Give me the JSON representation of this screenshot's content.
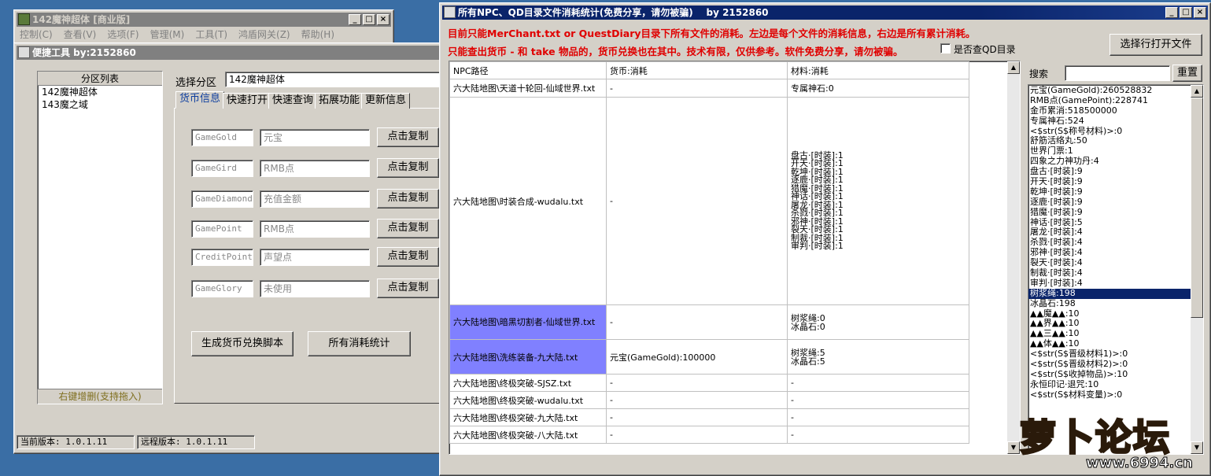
{
  "win1": {
    "title": "142魔神超体 [商业版]",
    "menu": [
      "控制(C)",
      "查看(V)",
      "选项(F)",
      "管理(M)",
      "工具(T)",
      "鸿盾网关(Z)",
      "帮助(H)"
    ]
  },
  "win2": {
    "title": "便捷工具 by:2152860",
    "partition_header": "分区列表",
    "partitions": [
      "142魔神超体",
      "143魔之域"
    ],
    "partition_footer": "右键增删(支持拖入)",
    "select_label": "选择分区",
    "select_value": "142魔神超体",
    "tabs": [
      "货币信息",
      "快速打开",
      "快速查询",
      "拓展功能",
      "更新信息"
    ],
    "currency_rows": [
      {
        "code": "GameGold",
        "name": "元宝",
        "btn": "点击复制"
      },
      {
        "code": "GameGird",
        "name": "RMB点",
        "btn": "点击复制"
      },
      {
        "code": "GameDiamond",
        "name": "充值金额",
        "btn": "点击复制"
      },
      {
        "code": "GamePoint",
        "name": "RMB点",
        "btn": "点击复制"
      },
      {
        "code": "CreditPoint",
        "name": "声望点",
        "btn": "点击复制"
      },
      {
        "code": "GameGlory",
        "name": "未使用",
        "btn": "点击复制"
      }
    ],
    "gen_btn": "生成货币兑换脚本",
    "stats_btn": "所有消耗统计",
    "local_version": "当前版本: 1.0.1.11",
    "remote_version": "远程版本: 1.0.1.11"
  },
  "win3": {
    "title": "所有NPC、QD目录文件消耗统计(免费分享，请勿被骗)    by 2152860",
    "notice1": "目前只能MerChant.txt or QuestDiary目录下所有文件的消耗。左边是每个文件的消耗信息，右边是所有累计消耗。",
    "notice2": "只能查出货币 - 和 take 物品的，货币兑换也在其中。技术有限，仅供参考。软件免费分享，请勿被骗。",
    "checkbox_label": "是否查QD目录",
    "open_btn": "选择行打开文件",
    "search_label": "搜索",
    "reset_btn": "重置",
    "columns": [
      "NPC路径",
      "货币:消耗",
      "材料:消耗"
    ],
    "rows": [
      {
        "path": "六大陆地图\\天道十轮回-仙域世界.txt",
        "money": "-",
        "mats": [
          "专属神石:0"
        ]
      },
      {
        "path": "六大陆地图\\时装合成-wudalu.txt",
        "money": "-",
        "mats": [
          "盘古·[时装]:1",
          "开天·[时装]:1",
          "乾坤·[时装]:1",
          "逐鹿·[时装]:1",
          "猎魔·[时装]:1",
          "神话·[时装]:1",
          "屠龙·[时装]:1",
          "杀戮·[时装]:1",
          "邪神·[时装]:1",
          "裂天·[时装]:1",
          "制裁·[时装]:1",
          "审判·[时装]:1"
        ]
      },
      {
        "path": "六大陆地图\\暗黑切割者-仙域世界.txt",
        "money": "-",
        "mats": [
          "树浆绳:0",
          "冰晶石:0"
        ]
      },
      {
        "path": "六大陆地图\\洗练装备-九大陆.txt",
        "money": "元宝(GameGold):100000",
        "mats": [
          "树浆绳:5",
          "冰晶石:5"
        ]
      },
      {
        "path": "六大陆地图\\终极突破-SJSZ.txt",
        "money": "-",
        "mats": [
          "-"
        ]
      },
      {
        "path": "六大陆地图\\终极突破-wudalu.txt",
        "money": "-",
        "mats": [
          "-"
        ]
      },
      {
        "path": "六大陆地图\\终极突破-九大陆.txt",
        "money": "-",
        "mats": [
          "-"
        ]
      },
      {
        "path": "六大陆地图\\终极突破-八大陆.txt",
        "money": "-",
        "mats": [
          "-"
        ]
      }
    ],
    "totals": [
      "元宝(GameGold):260528832",
      "RMB点(GamePoint):228741",
      "金币累消:518500000",
      "专属神石:524",
      "<$str(S$称号材料)>:0",
      "舒筋活络丸:50",
      "世界门票:1",
      "四象之力神功丹:4",
      "盘古·[时装]:9",
      "开天·[时装]:9",
      "乾坤·[时装]:9",
      "逐鹿·[时装]:9",
      "猎魔·[时装]:9",
      "神话·[时装]:5",
      "屠龙·[时装]:4",
      "杀戮·[时装]:4",
      "邪神·[时装]:4",
      "裂天·[时装]:4",
      "制裁·[时装]:4",
      "审判·[时装]:4",
      "树浆绳:198",
      "冰晶石:198",
      "▲▲魔▲▲:10",
      "▲▲界▲▲:10",
      "▲▲三▲▲:10",
      "▲▲体▲▲:10",
      "<$str(S$晋级材料1)>:0",
      "<$str(S$晋级材料2)>:0",
      "<$str(S$收掉物品)>:10",
      "永恒印记·退咒:10",
      "<$str(S$材料变量)>:0"
    ],
    "selected_total_index": 20
  },
  "watermark": {
    "text": "萝卜论坛",
    "url": "www.6994.cn"
  }
}
